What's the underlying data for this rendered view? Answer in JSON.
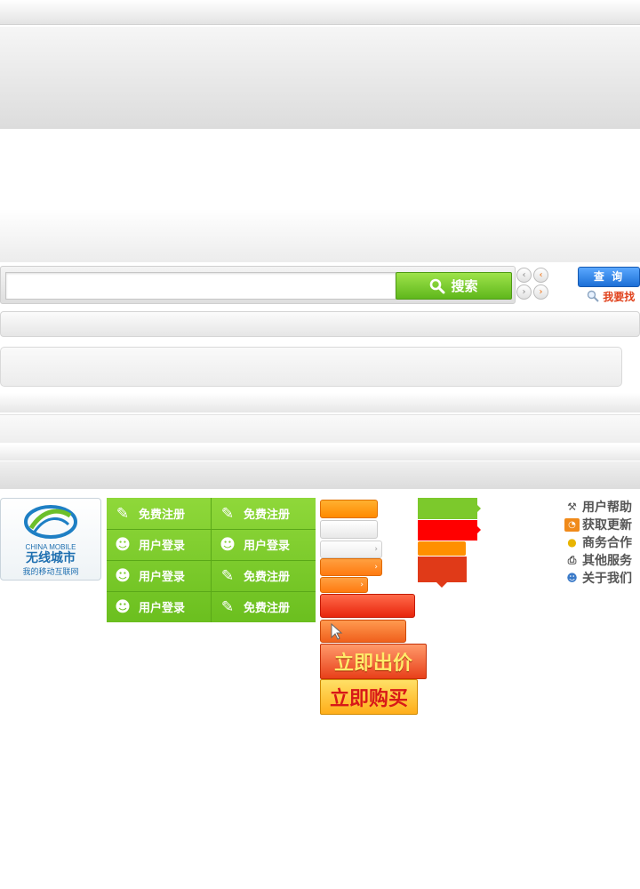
{
  "search": {
    "value": "",
    "placeholder": "",
    "button_label": "搜索"
  },
  "pager": {
    "prev_label": "‹",
    "next_label": "›"
  },
  "query_button_label": "查 询",
  "find_link_label": "我要找",
  "logo": {
    "brand_en": "CHINA MOBILE",
    "brand_cn": "无线城市",
    "slogan": "我的移动互联网"
  },
  "green_grid": [
    {
      "label": "免费注册",
      "icon": "pencil-icon"
    },
    {
      "label": "免费注册",
      "icon": "pencil-icon"
    },
    {
      "label": "用户登录",
      "icon": "add-user-icon"
    },
    {
      "label": "用户登录",
      "icon": "add-user-icon"
    },
    {
      "label": "用户登录",
      "icon": "add-user-icon"
    },
    {
      "label": "免费注册",
      "icon": "pencil-icon"
    },
    {
      "label": "用户登录",
      "icon": "add-user-icon"
    },
    {
      "label": "免费注册",
      "icon": "pencil-icon"
    }
  ],
  "big_buttons": {
    "bid_label": "立即出价",
    "buy_label": "立即购买"
  },
  "side_links": [
    {
      "label": "用户帮助",
      "icon": "tools-icon"
    },
    {
      "label": "获取更新",
      "icon": "rss-icon"
    },
    {
      "label": "商务合作",
      "icon": "lightbulb-icon"
    },
    {
      "label": "其他服务",
      "icon": "printer-icon"
    },
    {
      "label": "关于我们",
      "icon": "users-icon"
    }
  ],
  "colors": {
    "green": "#7cc92c",
    "orange": "#ff8a00",
    "red": "#ff0000",
    "brick": "#e03a18",
    "blue": "#1c6fd6"
  }
}
